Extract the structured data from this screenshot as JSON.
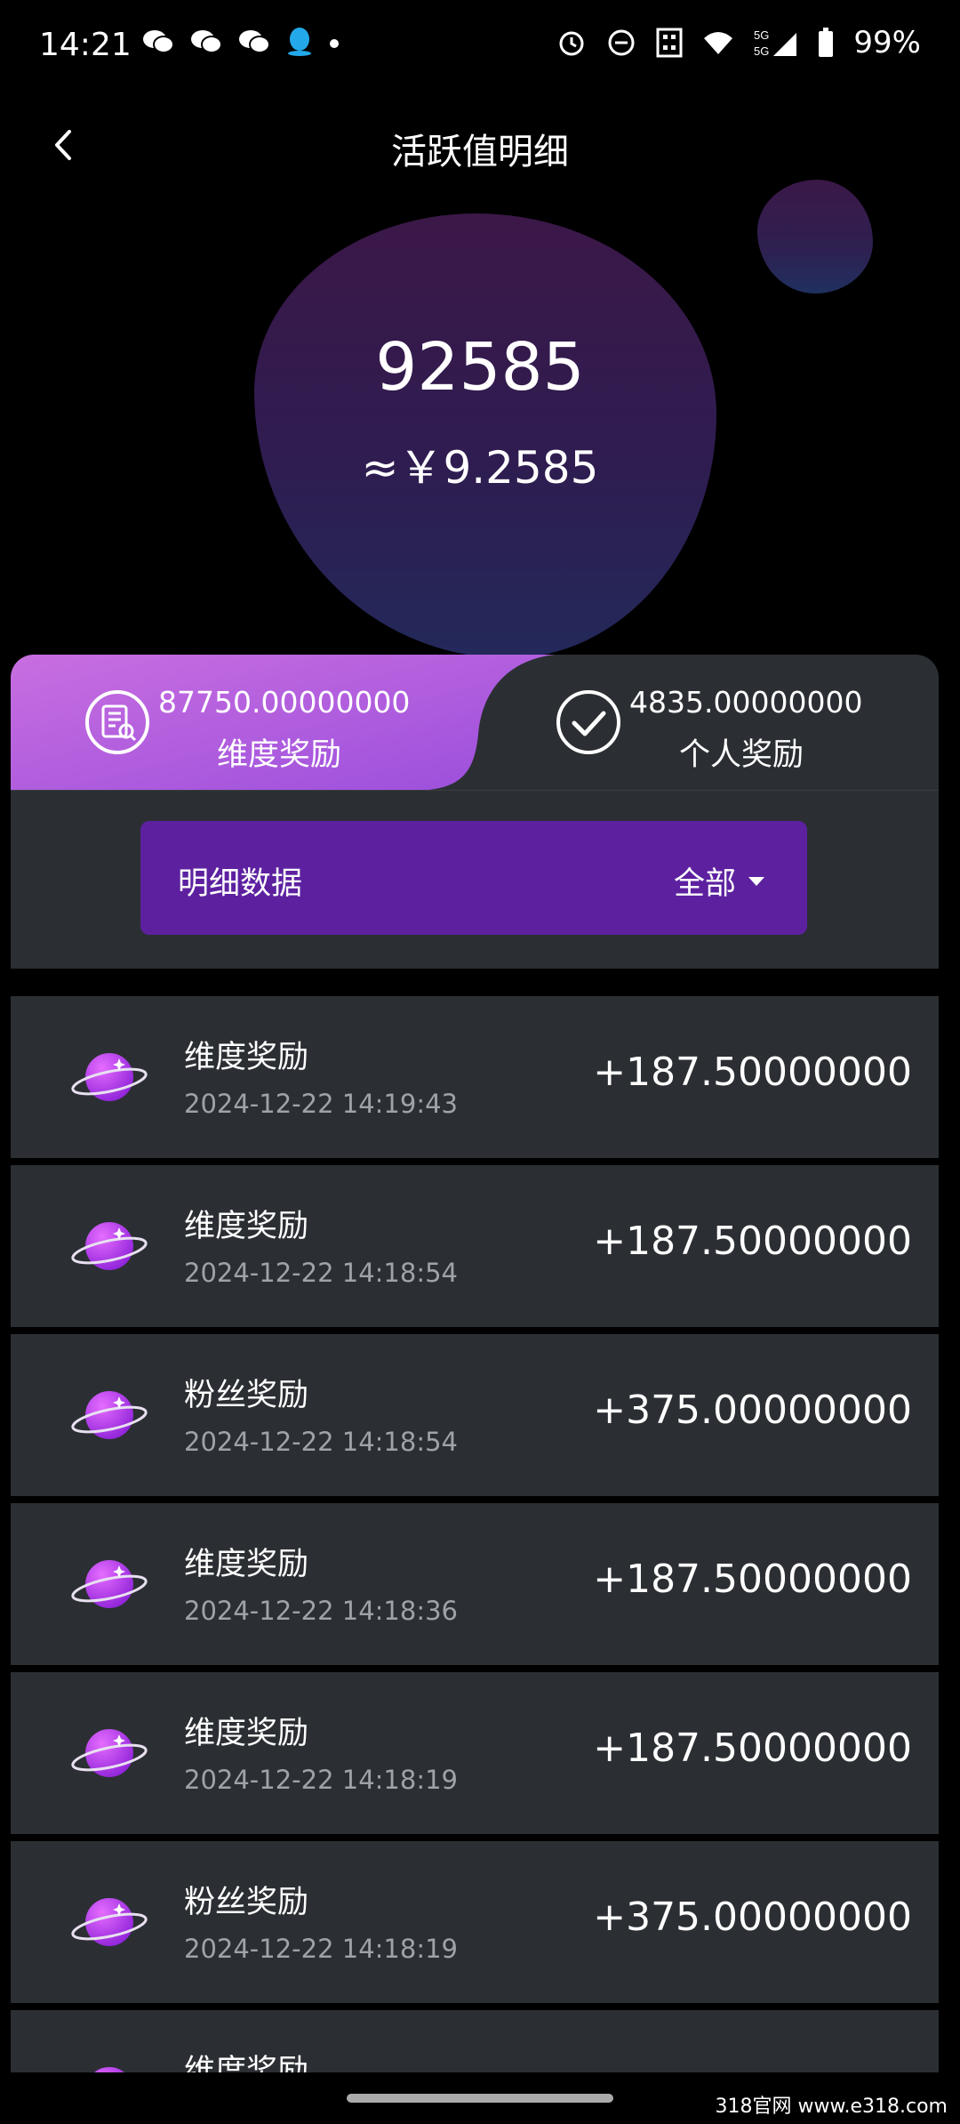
{
  "status_bar": {
    "time": "14:21",
    "battery": "99%",
    "network": "5G",
    "icons": [
      "wechat-icon",
      "wechat-icon",
      "wechat-icon",
      "qq-icon",
      "alarm-icon",
      "dnd-icon",
      "nfc-icon",
      "wifi-icon",
      "signal-icon",
      "battery-icon"
    ]
  },
  "header": {
    "title": "活跃值明细"
  },
  "balance": {
    "value": "92585",
    "money": "≈￥9.2585"
  },
  "summary": {
    "left": {
      "amount": "87750.00000000",
      "label": "维度奖励"
    },
    "right": {
      "amount": "4835.00000000",
      "label": "个人奖励"
    }
  },
  "filter": {
    "label": "明细数据",
    "value": "全部"
  },
  "records": [
    {
      "title": "维度奖励",
      "time": "2024-12-22 14:19:43",
      "amount": "+187.50000000"
    },
    {
      "title": "维度奖励",
      "time": "2024-12-22 14:18:54",
      "amount": "+187.50000000"
    },
    {
      "title": "粉丝奖励",
      "time": "2024-12-22 14:18:54",
      "amount": "+375.00000000"
    },
    {
      "title": "维度奖励",
      "time": "2024-12-22 14:18:36",
      "amount": "+187.50000000"
    },
    {
      "title": "维度奖励",
      "time": "2024-12-22 14:18:19",
      "amount": "+187.50000000"
    },
    {
      "title": "粉丝奖励",
      "time": "2024-12-22 14:18:19",
      "amount": "+375.00000000"
    },
    {
      "title": "维度奖励"
    }
  ],
  "watermark": "318官网 www.e318.com",
  "colors": {
    "accent": "#5d21a0",
    "card": "#2b2f33",
    "purple_gradient_start": "#d87ce8",
    "purple_gradient_end": "#8a44d8"
  }
}
